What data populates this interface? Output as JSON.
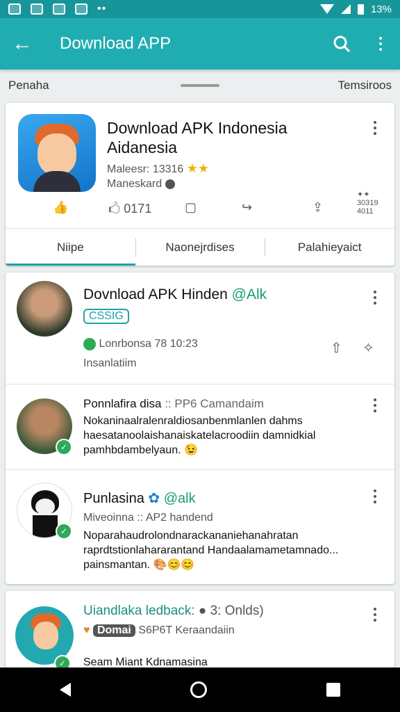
{
  "statusbar": {
    "battery_text": "13%"
  },
  "appbar": {
    "title": "Download APP"
  },
  "subheader": {
    "left": "Penaha",
    "right": "Temsiroos"
  },
  "app_card": {
    "title_line1": "Download APK Indonesia",
    "title_line2": "Aidanesia",
    "meta1": "Maleesr: 13316",
    "meta2": "Maneskard",
    "actions": {
      "like_count": "0171",
      "corner": "30319 4011"
    },
    "tabs": [
      "Niipe",
      "Naonejrdises",
      "Palahieyaict"
    ]
  },
  "feed": {
    "post1": {
      "title": "Dovnload APK Hinden",
      "handle": "@Alk",
      "tag": "CSSIG",
      "meta": "Lonrbonsa 78 10:23",
      "sub": "Insanlatiim"
    },
    "post2": {
      "title": "Ponnlafira disa",
      "sub_inline": ":: PP6 Camandaim",
      "body": "Nokaninaalralenraldiosanbenmlanlen dahms haesatanoolaishanaiskatelacroodiin damnidkial pamhbdambelyaun."
    },
    "post3": {
      "title": "Punlasina",
      "handle": "@alk",
      "sub": "Miveoinna :: AP2 handend",
      "body": "Noparahaudrolondnarackananiehanahratan raprdtstionlahararantand Handaalamametamnado... painsmantan."
    },
    "post4": {
      "title": "Uiandlaka ledback:",
      "title_extra": "3: Onlds)",
      "tag": "Domai",
      "sub": "S6P6T Keraandaiin",
      "body": "Seam Miant Kdnamasina"
    }
  },
  "colors": {
    "primary": "#20adb1",
    "status": "#17969a",
    "accent": "#17a06b"
  }
}
